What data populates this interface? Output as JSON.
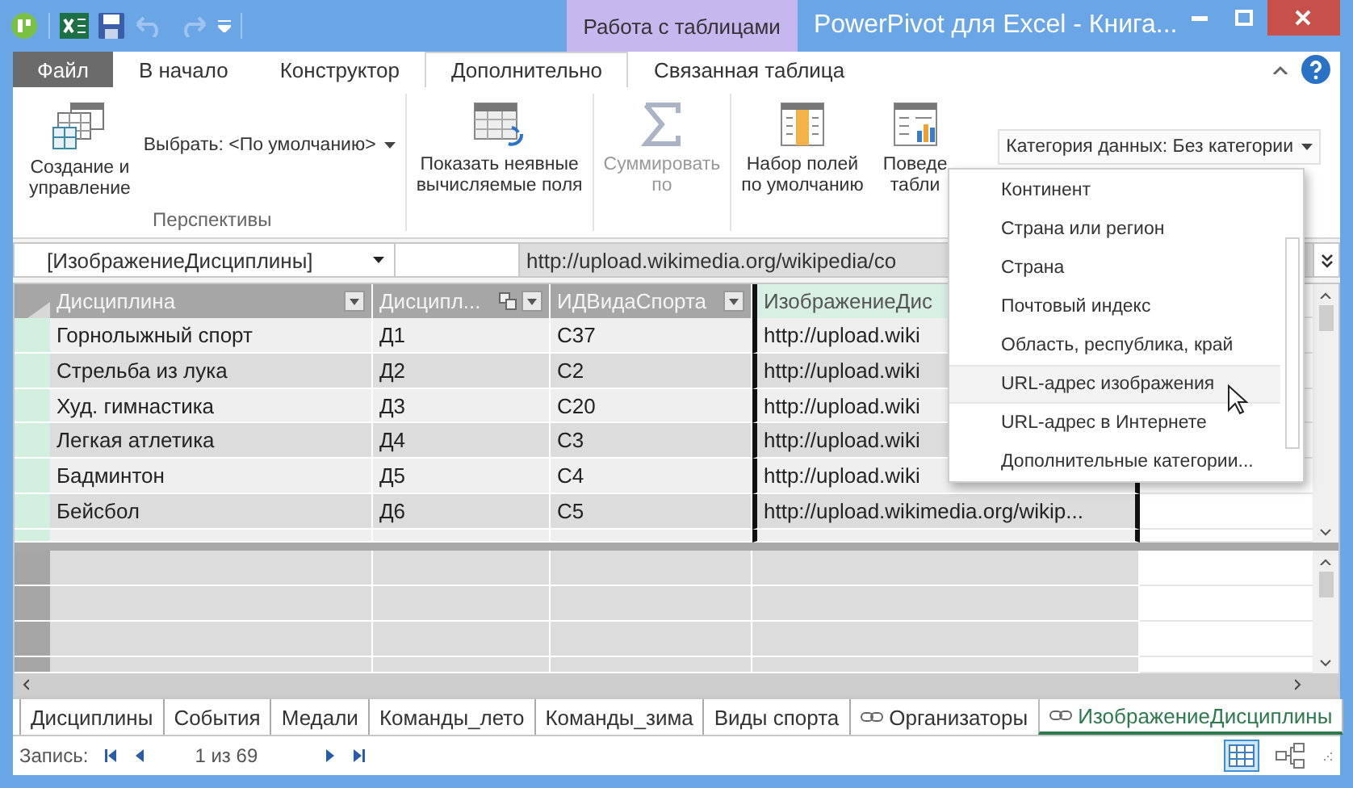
{
  "title_bar": {
    "context_group": "Работа с таблицами",
    "title": "PowerPivot для Excel - Книга..."
  },
  "ribbon_tabs": [
    {
      "label": "Файл",
      "kind": "file",
      "selected": false
    },
    {
      "label": "В начало",
      "kind": "tab",
      "selected": false
    },
    {
      "label": "Конструктор",
      "kind": "tab",
      "selected": false
    },
    {
      "label": "Дополнительно",
      "kind": "tab",
      "selected": true
    },
    {
      "label": "Связанная таблица",
      "kind": "context",
      "selected": false
    }
  ],
  "ribbon": {
    "perspectives": {
      "manage_lines": [
        "Создание и",
        "управление"
      ],
      "select": "Выбрать: <По умолчанию>",
      "group_label": "Перспективы"
    },
    "buttons": [
      {
        "kind": "implicit",
        "lines": [
          "Показать неявные",
          "вычисляемые поля"
        ],
        "disabled": false
      },
      {
        "kind": "summarize",
        "lines": [
          "Суммировать",
          "по"
        ],
        "disabled": true
      },
      {
        "kind": "fieldset",
        "lines": [
          "Набор полей",
          "по умолчанию"
        ],
        "disabled": false
      },
      {
        "kind": "behavior",
        "lines": [
          "Поведе",
          "табли"
        ],
        "disabled": false
      }
    ],
    "data_category": "Категория данных: Без категории"
  },
  "data_category_menu": {
    "items": [
      {
        "label": "Континент",
        "highlighted": false
      },
      {
        "label": "Страна или регион",
        "highlighted": false
      },
      {
        "label": "Страна",
        "highlighted": false
      },
      {
        "label": "Почтовый индекс",
        "highlighted": false
      },
      {
        "label": "Область, республика, край",
        "highlighted": false
      },
      {
        "label": "URL-адрес изображения",
        "highlighted": true
      },
      {
        "label": "URL-адрес в Интернете",
        "highlighted": false
      },
      {
        "label": "Дополнительные категории...",
        "highlighted": false
      }
    ]
  },
  "formula_bar": {
    "name_box": "[ИзображениеДисциплины]",
    "formula": "http://upload.wikimedia.org/wikipedia/co"
  },
  "table": {
    "columns": [
      {
        "label": "Дисциплина",
        "selected": false,
        "related": false
      },
      {
        "label": "Дисципл...",
        "selected": false,
        "related": true
      },
      {
        "label": "ИДВидаСпорта",
        "selected": false,
        "related": false
      },
      {
        "label": "ИзображениеДис",
        "selected": true,
        "related": false
      }
    ],
    "rows": [
      [
        "Горнолыжный спорт",
        "Д1",
        "С37",
        "http://upload.wiki"
      ],
      [
        "Стрельба из лука",
        "Д2",
        "С2",
        "http://upload.wiki"
      ],
      [
        "Худ. гимнастика",
        "Д3",
        "С20",
        "http://upload.wiki"
      ],
      [
        "Легкая атлетика",
        "Д4",
        "С3",
        "http://upload.wiki"
      ],
      [
        "Бадминтон",
        "Д5",
        "С4",
        "http://upload.wiki"
      ],
      [
        "Бейсбол",
        "Д6",
        "С5",
        "http://upload.wikimedia.org/wikip..."
      ]
    ]
  },
  "sheet_tabs": [
    {
      "label": "Дисциплины",
      "linked": false,
      "selected": false
    },
    {
      "label": "События",
      "linked": false,
      "selected": false
    },
    {
      "label": "Медали",
      "linked": false,
      "selected": false
    },
    {
      "label": "Команды_лето",
      "linked": false,
      "selected": false
    },
    {
      "label": "Команды_зима",
      "linked": false,
      "selected": false
    },
    {
      "label": "Виды спорта",
      "linked": false,
      "selected": false
    },
    {
      "label": "Организаторы",
      "linked": true,
      "selected": false
    },
    {
      "label": "ИзображениеДисциплины",
      "linked": true,
      "selected": true
    }
  ],
  "status_bar": {
    "record_label": "Запись:",
    "position": "1 из 69",
    "views": [
      {
        "kind": "grid",
        "selected": true
      },
      {
        "kind": "diagram",
        "selected": false
      }
    ]
  }
}
